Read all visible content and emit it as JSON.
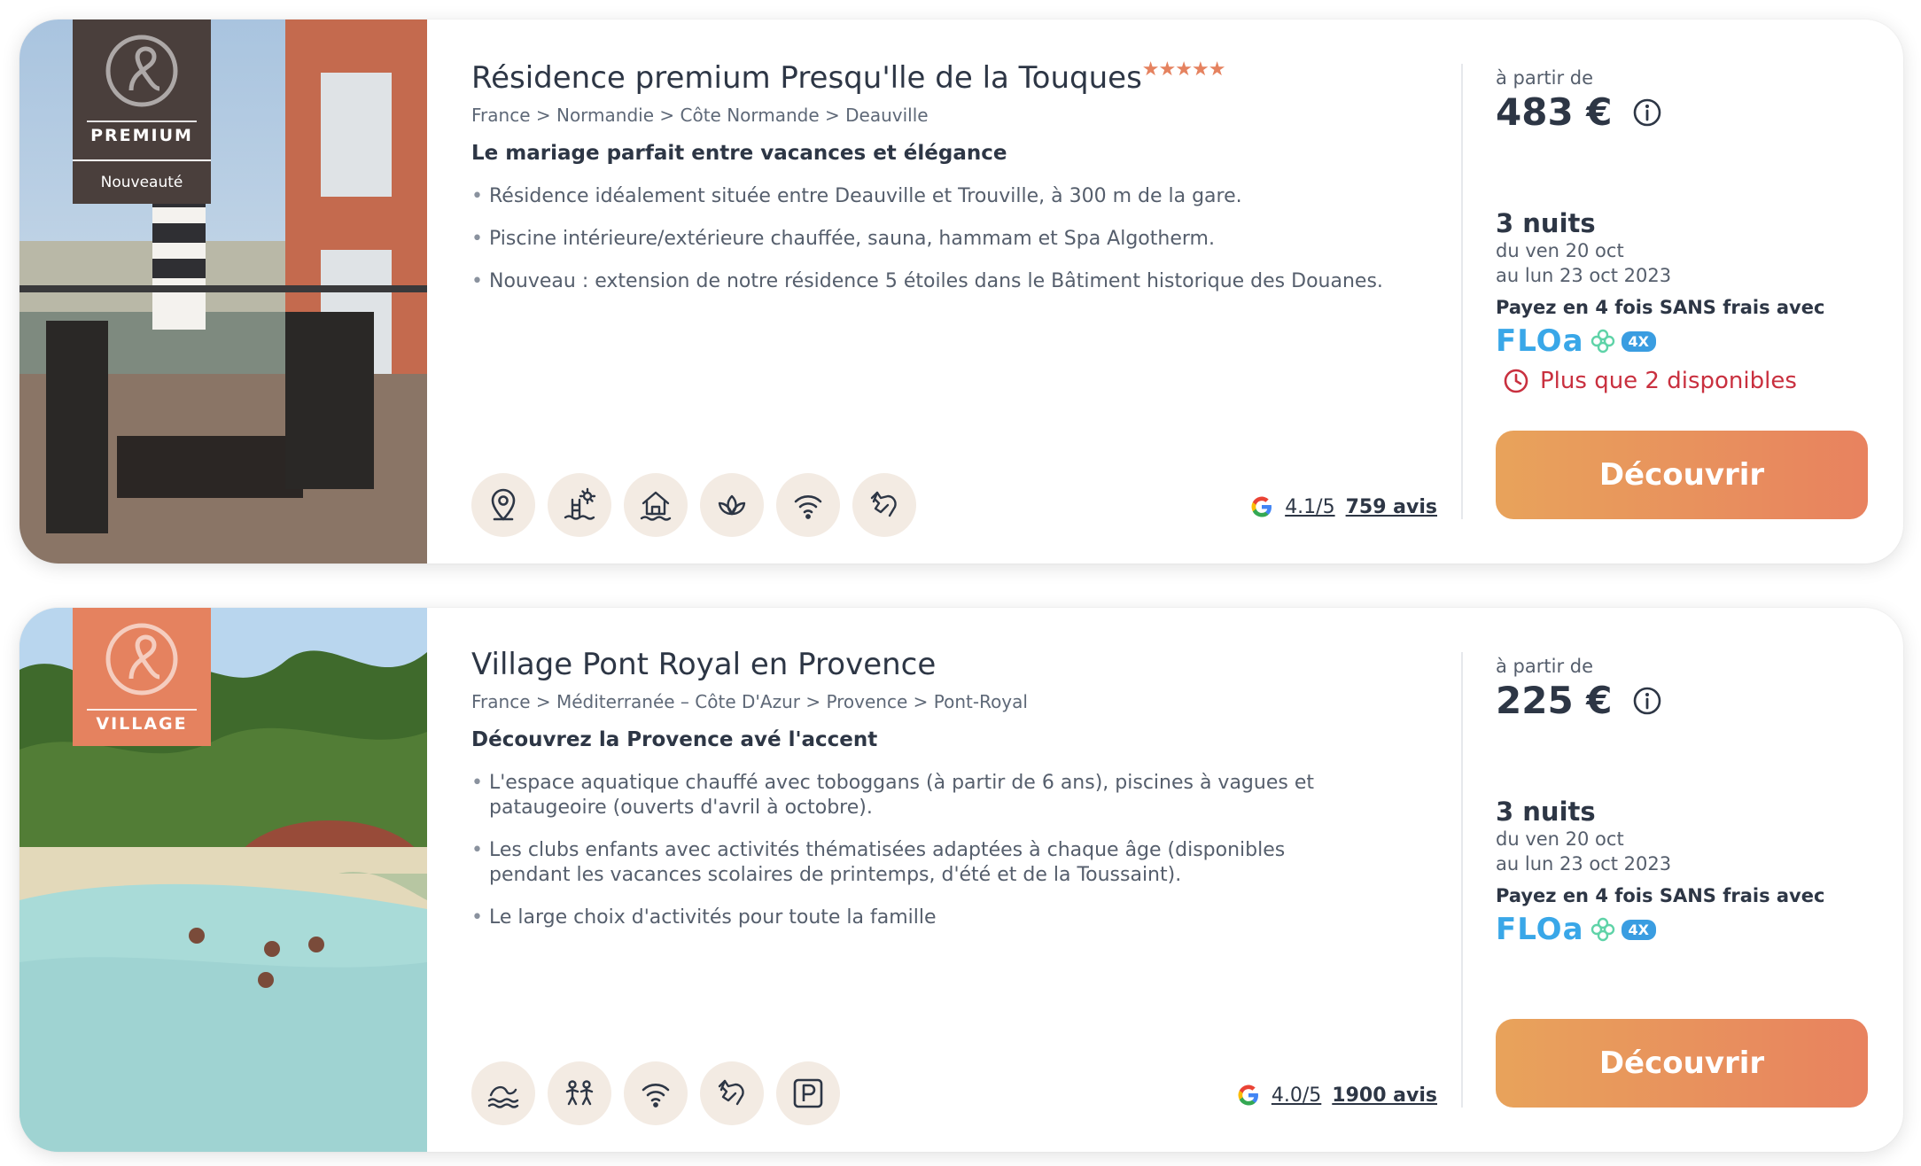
{
  "accent_color": "#e5825f",
  "cards": [
    {
      "badge_label": "PREMIUM",
      "badge_sub": "Nouveauté",
      "title": "Résidence premium Presqu'lle de la Touques",
      "stars": "★★★★★",
      "breadcrumb": "France > Normandie > Côte Normande > Deauville",
      "tagline": "Le mariage parfait entre vacances et élégance",
      "bullets": [
        "Résidence idéalement située entre Deauville et Trouville, à 300 m de la gare.",
        "Piscine intérieure/extérieure chauffée, sauna, hammam et Spa Algotherm.",
        "Nouveau : extension de notre résidence 5 étoiles dans le Bâtiment historique des Douanes."
      ],
      "amenity_icons": [
        "location-pin-icon",
        "heated-pool-icon",
        "house-water-icon",
        "spa-lotus-icon",
        "wifi-icon",
        "pets-allowed-icon"
      ],
      "rating": "4.1/5",
      "reviews": "759 avis",
      "price_from": "à partir de",
      "price": "483 €",
      "nights": "3 nuits",
      "date_from": "du ven 20 oct",
      "date_to": "au lun 23 oct 2023",
      "pay_text": "Payez en 4 fois SANS frais avec",
      "floa_logo": "FLOa",
      "floa_badge": "4X",
      "availability": "Plus que 2 disponibles",
      "cta": "Découvrir"
    },
    {
      "badge_label": "VILLAGE",
      "title": "Village Pont Royal en Provence",
      "breadcrumb": "France > Méditerranée – Côte D'Azur > Provence > Pont-Royal",
      "tagline": "Découvrez la Provence avé l'accent",
      "bullets": [
        "L'espace aquatique chauffé avec toboggans (à partir de 6 ans), piscines à vagues et pataugeoire (ouverts d'avril à octobre).",
        "Les clubs enfants avec activités thématisées adaptées à chaque âge (disponibles pendant les vacances scolaires de printemps, d'été et de la Toussaint).",
        "Le large choix d'activités pour toute la famille"
      ],
      "amenity_icons": [
        "aquatic-space-icon",
        "kids-club-icon",
        "wifi-icon",
        "pets-allowed-icon",
        "parking-icon"
      ],
      "rating": "4.0/5",
      "reviews": "1900 avis",
      "price_from": "à partir de",
      "price": "225 €",
      "nights": "3 nuits",
      "date_from": "du ven 20 oct",
      "date_to": "au lun 23 oct 2023",
      "pay_text": "Payez en 4 fois SANS frais avec",
      "floa_logo": "FLOa",
      "floa_badge": "4X",
      "cta": "Découvrir"
    }
  ]
}
